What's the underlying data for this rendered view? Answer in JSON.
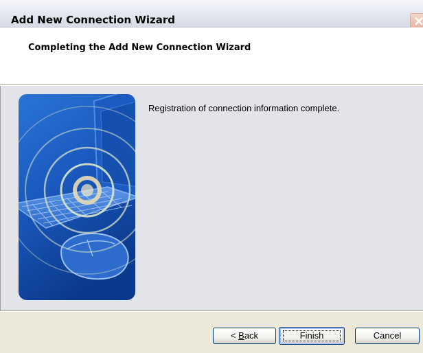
{
  "window": {
    "title": "Add New Connection Wizard"
  },
  "header": {
    "heading": "Completing the Add New Connection Wizard"
  },
  "main": {
    "message": "Registration of connection information complete."
  },
  "buttons": {
    "back_prefix": "< ",
    "back_accel": "B",
    "back_rest": "ack",
    "finish": "Finish",
    "cancel": "Cancel"
  },
  "icons": {
    "close": "close-icon",
    "illustration": "wireless-laptop-illustration"
  },
  "colors": {
    "illustration_blue": "#1e5fbf",
    "illustration_dark": "#0d3b8a",
    "button_border": "#003c74",
    "close_red": "#c4553b"
  }
}
